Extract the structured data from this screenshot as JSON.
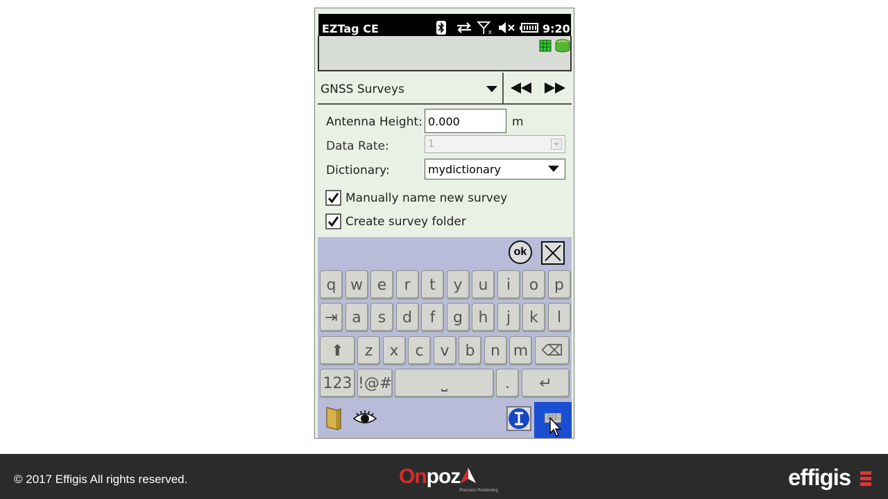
{
  "status_bar": {
    "app_title": "EZTag CE",
    "time": "9:20",
    "icons": [
      "bluetooth-icon",
      "sync-icon",
      "no-signal-icon",
      "mute-icon",
      "battery-icon"
    ]
  },
  "survey_selector": {
    "value": "GNSS Surveys",
    "prev_label": "◀◀",
    "next_label": "▶▶"
  },
  "form": {
    "antenna_height_label": "Antenna Height:",
    "antenna_height_value": "0.000",
    "antenna_height_unit": "m",
    "data_rate_label": "Data Rate:",
    "data_rate_value": "1",
    "dictionary_label": "Dictionary:",
    "dictionary_value": "mydictionary",
    "manual_name_label": "Manually name new survey",
    "create_folder_label": "Create survey folder"
  },
  "keyboard": {
    "ok_label": "ok",
    "row1": [
      "q",
      "w",
      "e",
      "r",
      "t",
      "y",
      "u",
      "i",
      "o",
      "p"
    ],
    "row2": [
      "a",
      "s",
      "d",
      "f",
      "g",
      "h",
      "j",
      "k",
      "l"
    ],
    "row3": [
      "z",
      "x",
      "c",
      "v",
      "b",
      "n",
      "m"
    ],
    "numbers_label": "123",
    "symbols_label": "!@#",
    "period_label": "."
  },
  "footer": {
    "copyright": "© 2017 Effigis All rights reserved.",
    "onpoz_on": "On",
    "onpoz_poz": "poz",
    "onpoz_tagline": "Precision Positioning",
    "effigis": "effigis"
  },
  "colors": {
    "screen_bg": "#e9f1e4",
    "keyboard_bg": "#b8bcd8",
    "footer_bg": "#2b2b2b",
    "brand_red": "#d92b2b"
  }
}
